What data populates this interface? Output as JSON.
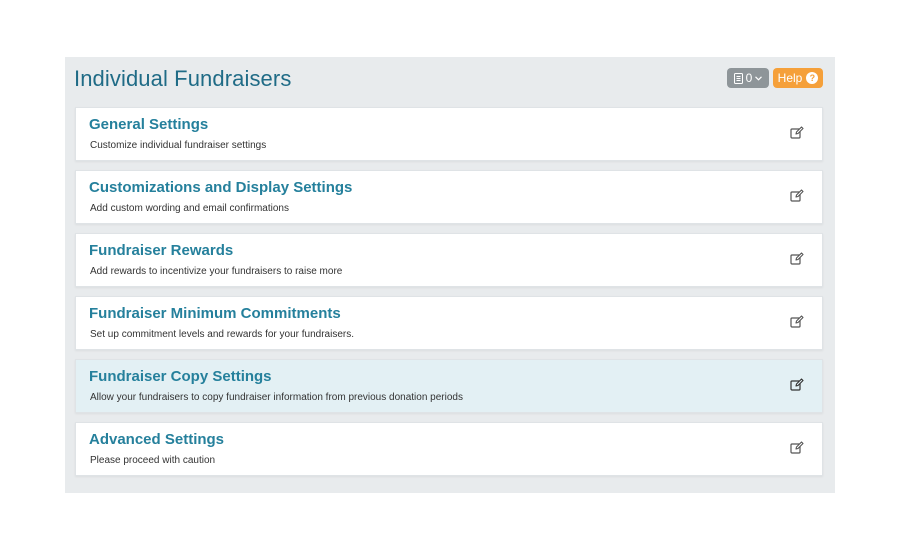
{
  "header": {
    "title": "Individual Fundraisers",
    "notes_count": "0",
    "help_label": "Help",
    "help_icon": "question-circle-icon"
  },
  "colors": {
    "title": "#1f6b86",
    "card_title": "#25809c",
    "help_button": "#f5a03a",
    "notes_button": "#8e9599",
    "panel_bg": "#e8ebed",
    "active_card_bg": "#e3f0f4"
  },
  "sections": [
    {
      "title": "General Settings",
      "description": "Customize individual fundraiser settings",
      "icon": "edit-icon"
    },
    {
      "title": "Customizations and Display Settings",
      "description": "Add custom wording and email confirmations",
      "icon": "edit-icon"
    },
    {
      "title": "Fundraiser Rewards",
      "description": "Add rewards to incentivize your fundraisers to raise more",
      "icon": "edit-icon"
    },
    {
      "title": "Fundraiser Minimum Commitments",
      "description": "Set up commitment levels and rewards for your fundraisers.",
      "icon": "edit-icon"
    },
    {
      "title": "Fundraiser Copy Settings",
      "description": "Allow your fundraisers to copy fundraiser information from previous donation periods",
      "icon": "edit-icon",
      "highlighted": true
    },
    {
      "title": "Advanced Settings",
      "description": "Please proceed with caution",
      "icon": "edit-icon"
    }
  ]
}
